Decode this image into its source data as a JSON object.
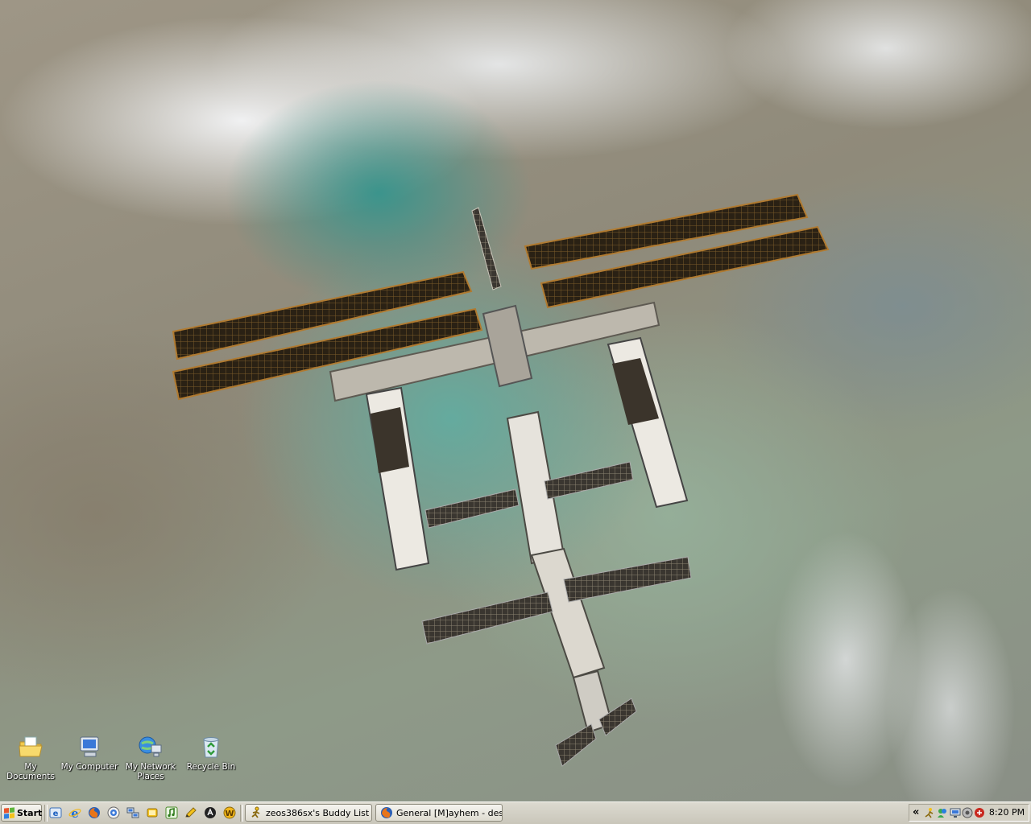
{
  "desktop": {
    "icons": [
      {
        "label": "My Documents",
        "icon": "my-documents-icon"
      },
      {
        "label": "My Computer",
        "icon": "my-computer-icon"
      },
      {
        "label": "My Network Places",
        "icon": "network-places-icon"
      },
      {
        "label": "Recycle Bin",
        "icon": "recycle-bin-icon"
      }
    ]
  },
  "taskbar": {
    "start_label": "Start",
    "quick_launch": [
      "ie-icon",
      "internet-explorer-icon",
      "firefox-icon",
      "outlook-icon",
      "network-icon",
      "messenger-icon",
      "winamp-icon",
      "pencil-icon",
      "media-icon",
      "w-icon"
    ],
    "tasks": [
      {
        "label": "zeos386sx's Buddy List ...",
        "icon": "aim-running-man-icon"
      },
      {
        "label": "General [M]ayhem - desk...",
        "icon": "firefox-icon"
      }
    ],
    "tray": {
      "chevron": "«",
      "icons": [
        "aim-icon",
        "msn-icon",
        "monitor-icon",
        "speaker-icon",
        "antivirus-icon"
      ],
      "clock": "8:20 PM"
    }
  },
  "colors": {
    "taskbar": "#d4d0c8",
    "desktop_water": "#4fa79a",
    "icon_text": "#ffffff"
  }
}
